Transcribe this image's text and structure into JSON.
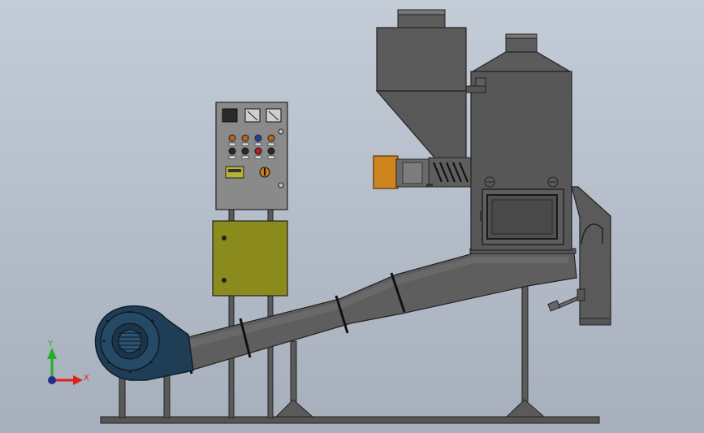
{
  "triad": {
    "x_label": "X",
    "y_label": "Y",
    "x_color": "#e0201a",
    "y_color": "#22b022",
    "z_color": "#2a2ad8"
  },
  "colors": {
    "background": "#b7c0cc",
    "steel": "#5a5a5a",
    "steel_dark": "#3e3e3e",
    "olive_box": "#8e8c1c",
    "blower": "#1e3f57",
    "orange_motor": "#d2881e",
    "frame": "#505050"
  },
  "icons": [
    "coordinate-triad",
    "blower-fan",
    "control-panel",
    "hopper",
    "cyclone-chamber"
  ]
}
